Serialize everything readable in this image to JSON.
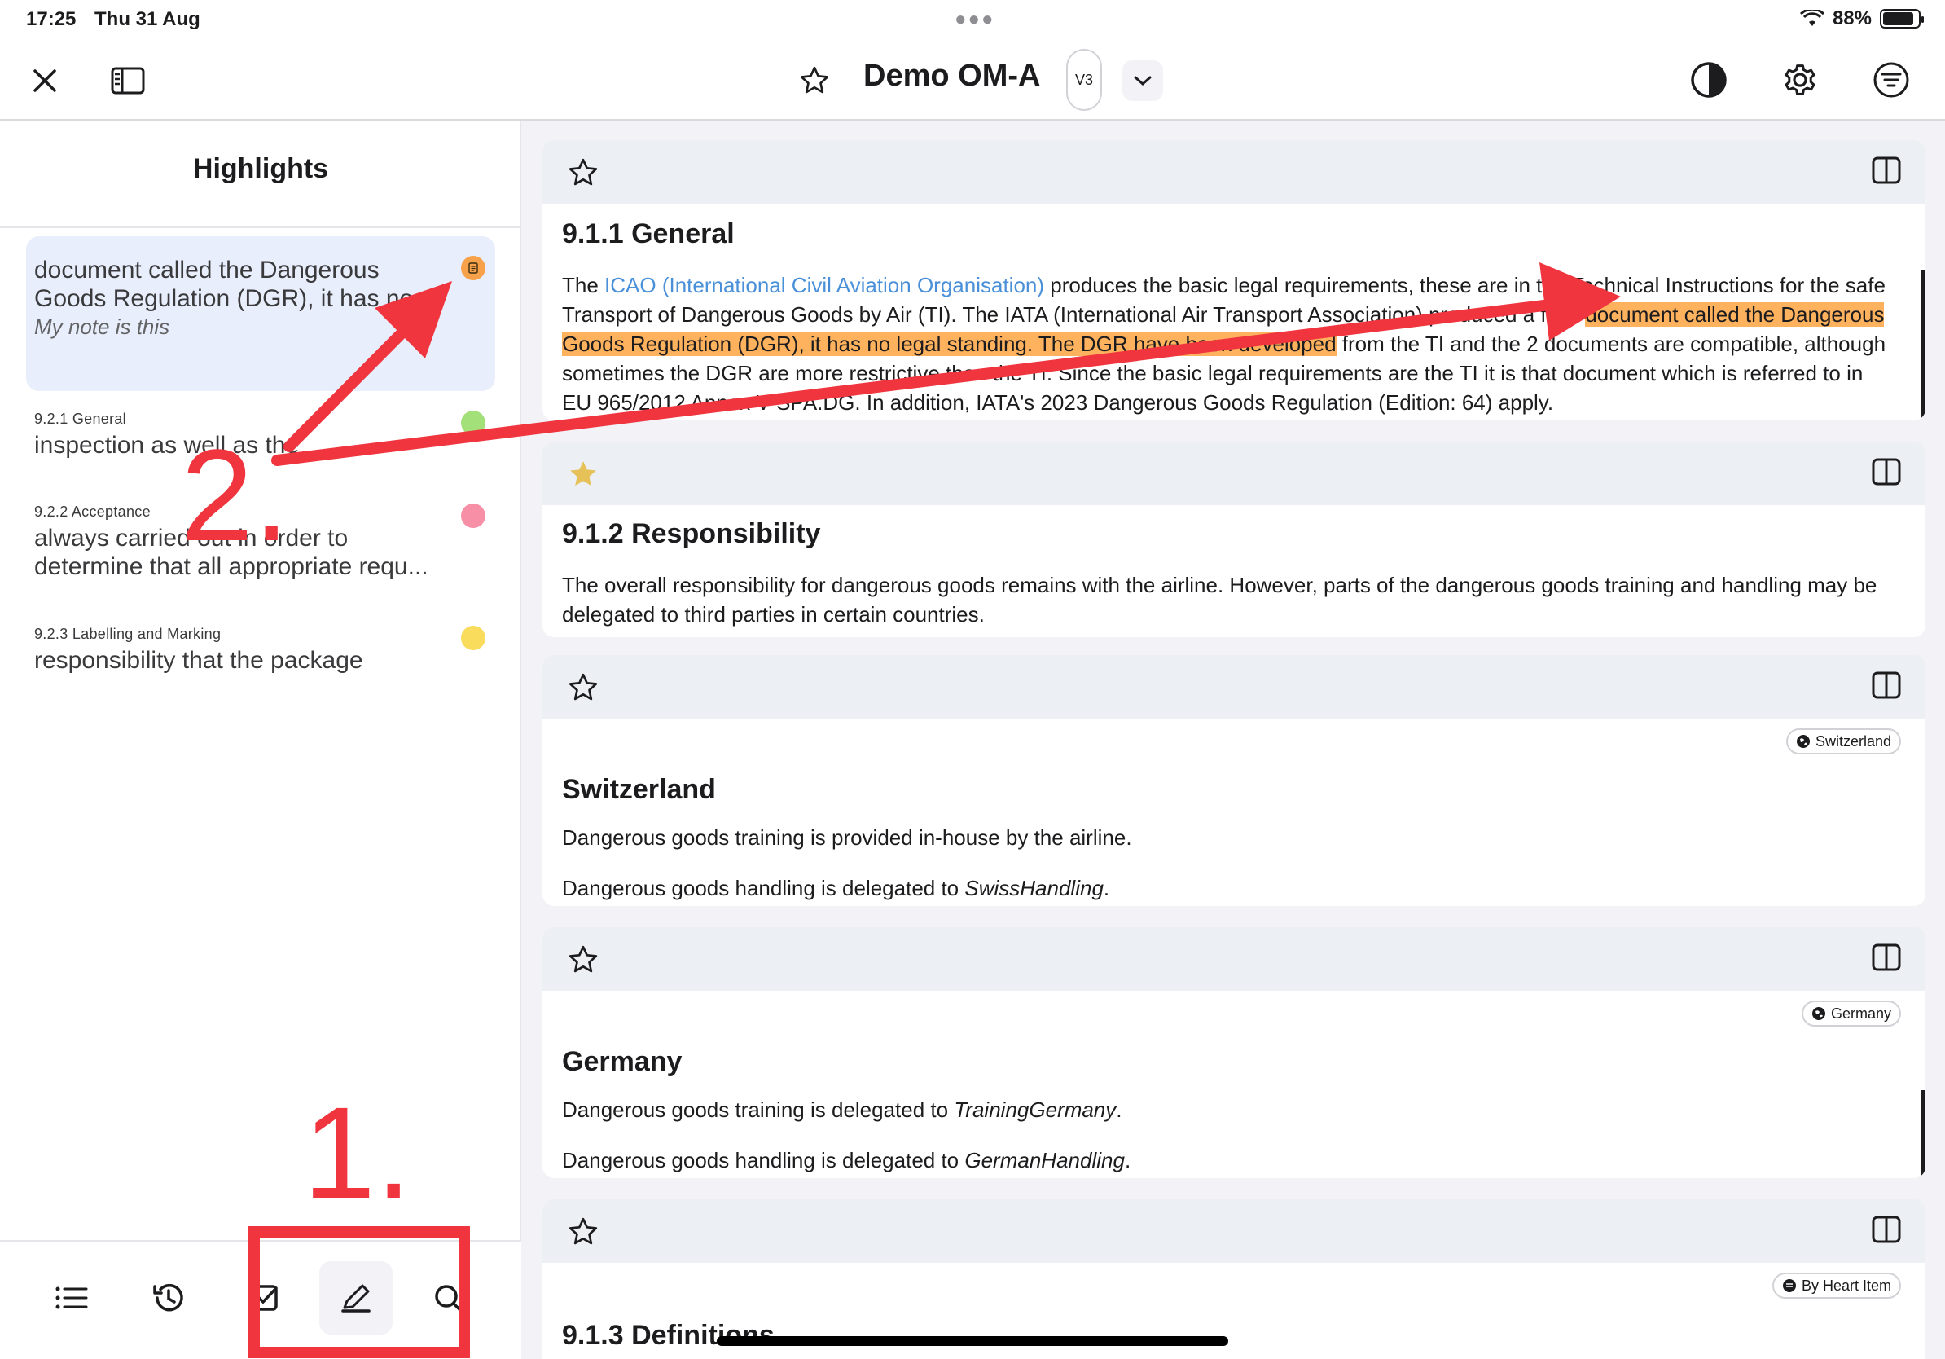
{
  "status_bar": {
    "time": "17:25",
    "date": "Thu 31 Aug",
    "battery": "88%",
    "battery_level": 0.88
  },
  "toolbar": {
    "title": "Demo OM-A",
    "version": "V3"
  },
  "sidebar": {
    "title": "Highlights",
    "items": [
      {
        "section": "",
        "text_line1": "document called the Dangerous",
        "text_line2": "Goods Regulation (DGR), it has no",
        "note": "My note is this",
        "color": "#f7a24a"
      },
      {
        "section": "9.2.1 General",
        "text_line1": "inspection as well as the",
        "text_line2": "",
        "note": "",
        "color": "#a3e07a"
      },
      {
        "section": "9.2.2 Acceptance",
        "text_line1": "always carried out in order to",
        "text_line2": "determine that all appropriate requ...",
        "note": "",
        "color": "#f78fa7"
      },
      {
        "section": "9.2.3 Labelling and Marking",
        "text_line1": "responsibility that the package",
        "text_line2": "",
        "note": "",
        "color": "#f9dc5c"
      }
    ]
  },
  "content": {
    "cards": [
      {
        "title": "9.1.1 General",
        "starred": false,
        "p_pre": "The ",
        "p_link": "ICAO (International Civil Aviation Organisation)",
        "p_mid": " produces the basic legal requirements, these are in the Technical Instructions for the safe Transport of Dangerous Goods by Air (TI). The IATA (International Air Transport Association) produced a field ",
        "p_highlight": "document called the Dangerous Goods Regulation (DGR), it has no legal standing. The DGR have been developed",
        "p_post": " from the TI and the 2 documents are compatible, although sometimes the DGR are more restrictive than the TI. Since the basic legal requirements are the TI it is that document which is referred to in EU 965/2012 Annex V-SPA.DG. In addition, IATA's 2023 Dangerous Goods Regulation (Edition: 64) apply."
      },
      {
        "title": "9.1.2 Responsibility",
        "starred": true,
        "p1": "The overall responsibility for dangerous goods remains with the airline. However, parts of the dangerous goods training and handling may be delegated to third parties in certain countries."
      },
      {
        "title": "Switzerland",
        "tag": "Switzerland",
        "p1": "Dangerous goods training is provided in-house by the airline.",
        "p2_pre": "Dangerous goods handling is delegated to ",
        "p2_em": "SwissHandling",
        "p2_post": "."
      },
      {
        "title": "Germany",
        "tag": "Germany",
        "p1_pre": "Dangerous goods training is delegated to ",
        "p1_em": "TrainingGermany",
        "p1_post": ".",
        "p2_pre": "Dangerous goods handling is delegated to ",
        "p2_em": "GermanHandling",
        "p2_post": "."
      },
      {
        "title": "9.1.3 Definitions",
        "tag": "By Heart Item"
      }
    ]
  },
  "annotations": {
    "label_1": "1.",
    "label_2": "2."
  },
  "colors": {
    "accent_annotation": "#f0353e",
    "highlight": "#ffb25e",
    "link": "#4a90d9",
    "star_filled": "#e5c158"
  }
}
